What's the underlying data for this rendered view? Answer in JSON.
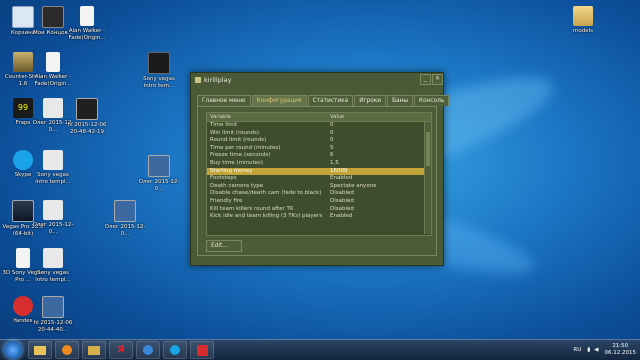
{
  "desktop": {
    "icons": [
      {
        "label": "Корзина"
      },
      {
        "label": "Мои Концов..."
      },
      {
        "label": "Alan Walker - Fade(Origin..."
      },
      {
        "label": "Counter-Str... 1.6"
      },
      {
        "label": "Alan Walker - Fade(Origin..."
      },
      {
        "label": "Sony vegas intro tem..."
      },
      {
        "label": "Fraps"
      },
      {
        "label": "Олег 2015-12-0..."
      },
      {
        "label": "hl 2015-12-06 20-48-42-19"
      },
      {
        "label": "Skype"
      },
      {
        "label": "Sony vegas intro templ..."
      },
      {
        "label": "Олег 2015-12-0..."
      },
      {
        "label": "Vegas Pro 12.0 (64-bit)"
      },
      {
        "label": "Олег 2015-12-0..."
      },
      {
        "label": "Олег 2015-12-0..."
      },
      {
        "label": "3D Sony Vegas Pro ..."
      },
      {
        "label": "Sony vegas intro templ..."
      },
      {
        "label": "Yandex"
      },
      {
        "label": "hl 2015-12-06 20-44-40..."
      },
      {
        "label": "models"
      }
    ]
  },
  "window": {
    "title": "kirillplay",
    "tabs": [
      "Главное меню",
      "Конфигурация",
      "Статистика",
      "Игроки",
      "Баны",
      "Консоль"
    ],
    "table": {
      "headers": [
        "Variable",
        "Value"
      ],
      "rows": [
        [
          "Time limit",
          "0"
        ],
        [
          "Win limit (rounds)",
          "0"
        ],
        [
          "Round limit (rounds)",
          "0"
        ],
        [
          "Time per round (minutes)",
          "5"
        ],
        [
          "Freeze time (seconds)",
          "6"
        ],
        [
          "Buy time (minutes)",
          "1.5"
        ],
        [
          "Starting money",
          "16000"
        ],
        [
          "Footsteps",
          "Enabled"
        ],
        [
          "Death camera type",
          "Spectate anyone"
        ],
        [
          "Disable chase/death cam (fade to black)",
          "Disabled"
        ],
        [
          "Friendly fire",
          "Disabled"
        ],
        [
          "Kill team killers round after TK",
          "Disabled"
        ],
        [
          "Kick idle and team killing (3 TKs) players",
          "Enabled"
        ]
      ]
    },
    "edit_label": "Edit..."
  },
  "taskbar": {
    "items": [
      "",
      "",
      "",
      "Я",
      "",
      "",
      ""
    ],
    "lang": "RU",
    "time": "21:50",
    "date": "06.12.2015"
  }
}
